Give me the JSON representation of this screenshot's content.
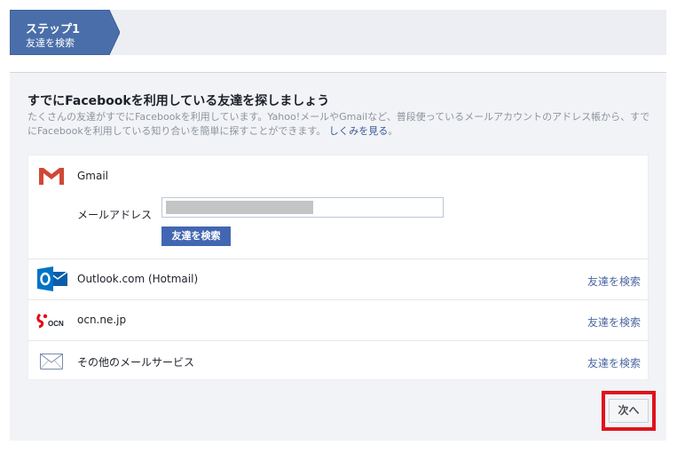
{
  "step": {
    "title": "ステップ1",
    "subtitle": "友達を検索"
  },
  "main": {
    "heading": "すでにFacebookを利用している友達を探しましょう",
    "description": "たくさんの友達がすでにFacebookを利用しています。Yahoo!メールやGmailなど、普段使っているメールアカウントのアドレス帳から、すでにFacebookを利用している知り合いを簡単に探すことができます。",
    "learn_more": "しくみを見る",
    "period": "。"
  },
  "providers": {
    "gmail": {
      "name": "Gmail",
      "email_label": "メールアドレス",
      "email_value": "",
      "find_button": "友達を検索"
    },
    "outlook": {
      "name": "Outlook.com (Hotmail)",
      "link": "友達を検索"
    },
    "ocn": {
      "name": "ocn.ne.jp",
      "logo_text": "OCN",
      "link": "友達を検索"
    },
    "other": {
      "name": "その他のメールサービス",
      "link": "友達を検索"
    }
  },
  "footer": {
    "next_button": "次へ"
  },
  "colors": {
    "step_tab": "#4a6ea9",
    "button_blue": "#4267b2",
    "link_blue": "#4b67a1",
    "highlight_red": "#e0121b",
    "outlook_blue": "#0072c6",
    "gmail_red": "#d14836"
  }
}
